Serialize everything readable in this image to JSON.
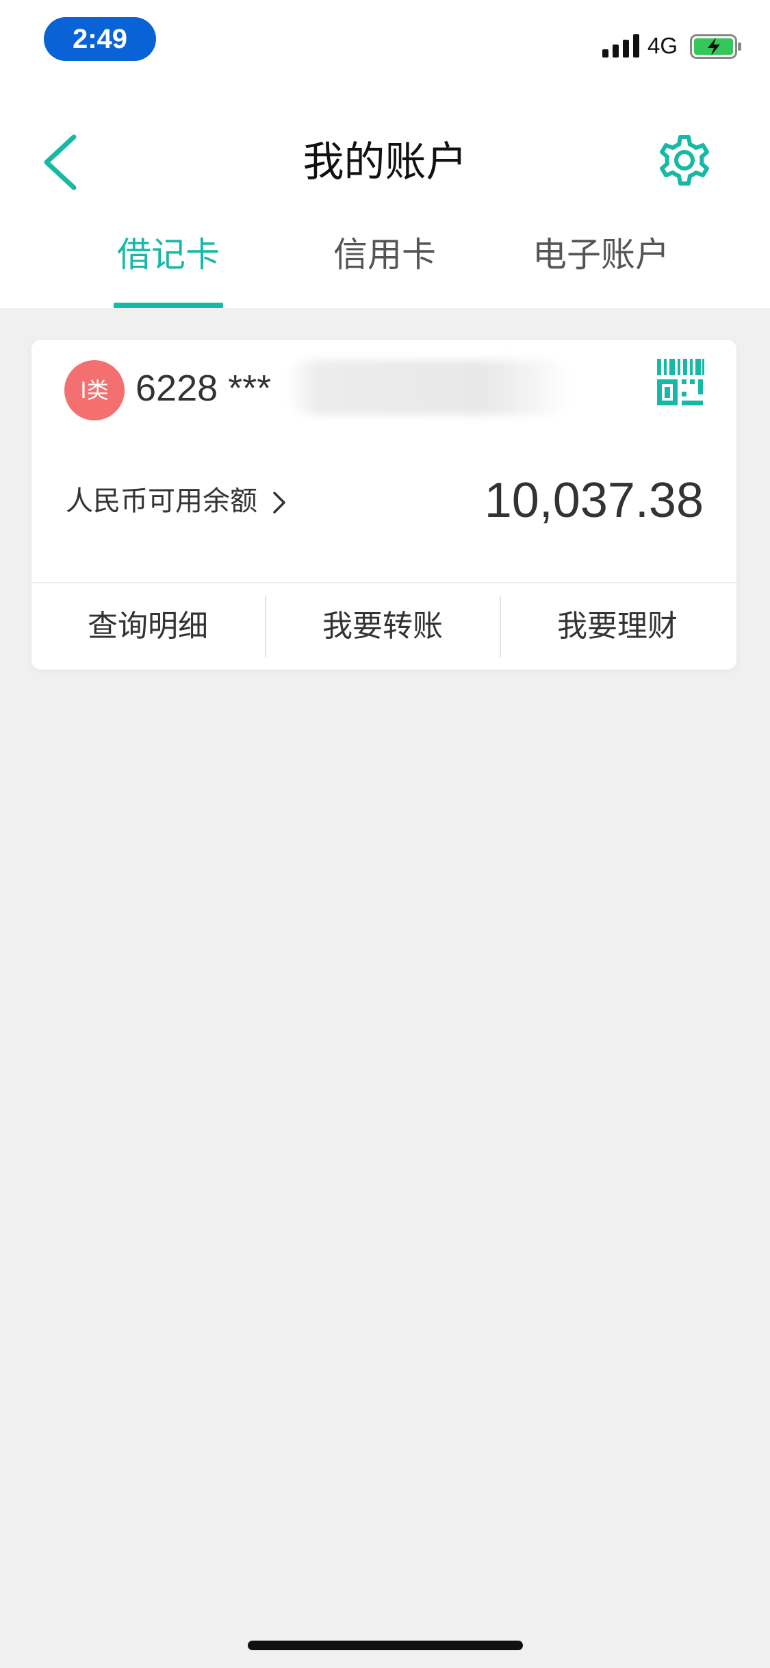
{
  "status_bar": {
    "time": "2:49",
    "network": "4G",
    "icons": {
      "signal": "signal-bars-icon",
      "battery": "battery-charging-icon"
    },
    "colors": {
      "time_pill": "#0a63d6",
      "battery_fill": "#34c759"
    }
  },
  "header": {
    "title": "我的账户",
    "icons": {
      "back": "chevron-left-icon",
      "settings": "gear-icon"
    },
    "accent_color": "#17b9a6"
  },
  "tabs": [
    {
      "label": "借记卡",
      "active": true
    },
    {
      "label": "信用卡",
      "active": false
    },
    {
      "label": "电子账户",
      "active": false
    }
  ],
  "card": {
    "type_badge": "I类",
    "number_prefix": "6228 ***",
    "balance_label": "人民币可用余额",
    "balance": "10,037.38",
    "icons": {
      "qr": "qr-code-icon",
      "arrow": "chevron-right-icon"
    },
    "badge_color": "#f46f6f",
    "actions": [
      "查询明细",
      "我要转账",
      "我要理财"
    ]
  }
}
